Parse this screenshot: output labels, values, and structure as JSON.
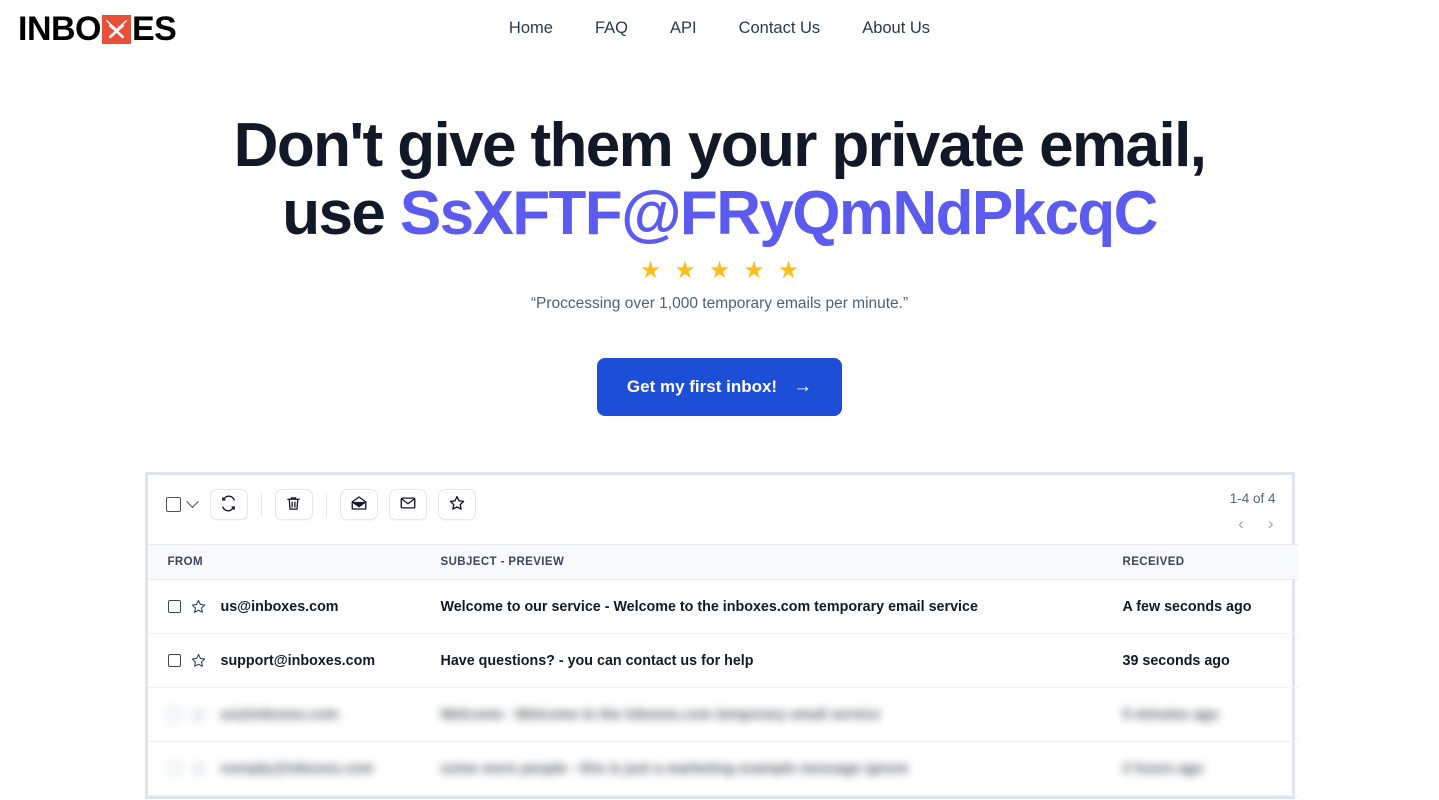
{
  "brand": {
    "name_part1": "INBO",
    "name_part2": "ES",
    "mark_icon": "envelope-x-icon",
    "mark_color": "#e8503a"
  },
  "nav": {
    "items": [
      {
        "label": "Home"
      },
      {
        "label": "FAQ"
      },
      {
        "label": "API"
      },
      {
        "label": "Contact Us"
      },
      {
        "label": "About Us"
      }
    ]
  },
  "hero": {
    "headline_line1": "Don't give them your private email,",
    "headline_use": "use ",
    "email": "SsXFTF@FRyQmNdPkcqC",
    "email_color": "#5b5bf0",
    "rating_stars": 5,
    "star_glyph": "★",
    "star_color": "#fbbf24",
    "quote": "“Proccessing over 1,000 temporary emails per minute.”",
    "cta_label": "Get my first inbox!",
    "cta_arrow": "→",
    "cta_color": "#1d4ed8"
  },
  "inbox": {
    "toolbar": {
      "select_all_icon": "checkbox-icon",
      "select_all_chevron_icon": "chevron-down-icon",
      "buttons": [
        {
          "name": "refresh-button",
          "icon": "refresh-icon"
        },
        {
          "name": "delete-button",
          "icon": "trash-icon"
        },
        {
          "name": "mark-read-button",
          "icon": "open-envelope-icon"
        },
        {
          "name": "mark-unread-button",
          "icon": "closed-envelope-icon"
        },
        {
          "name": "star-button",
          "icon": "star-outline-icon"
        }
      ]
    },
    "pagination": {
      "count_label": "1-4 of 4",
      "prev_glyph": "‹",
      "next_glyph": "›"
    },
    "columns": {
      "from": "FROM",
      "subject": "SUBJECT - PREVIEW",
      "received": "RECEIVED"
    },
    "rows": [
      {
        "from": "us@inboxes.com",
        "subject": "Welcome to our service - Welcome to the inboxes.com temporary email service",
        "received": "A few seconds ago",
        "blurred": false
      },
      {
        "from": "support@inboxes.com",
        "subject": "Have questions? - you can contact us for help",
        "received": "39 seconds ago",
        "blurred": false
      },
      {
        "from": "us@inboxes.com",
        "subject": "Welcome - Welcome to the inboxes.com temporary email service",
        "received": "5 minutes ago",
        "blurred": true
      },
      {
        "from": "noreply@inboxes.com",
        "subject": "some more people - this is just a marketing example message ignore",
        "received": "2 hours ago",
        "blurred": true
      }
    ]
  }
}
